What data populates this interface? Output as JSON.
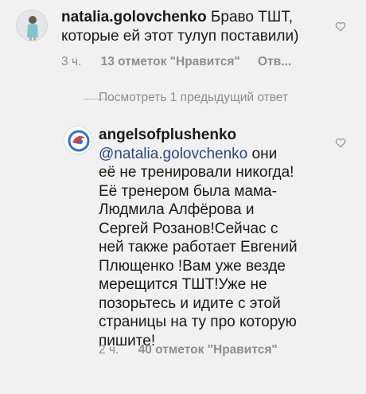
{
  "comment1": {
    "username": "natalia.golovchenko",
    "text_first": " Браво ТШТ,",
    "text_second": "которые ей этот тулуп поставили)",
    "time": "3 ч.",
    "likes": "13 отметок \"Нравится\"",
    "reply": "Отв..."
  },
  "view_previous": "Посмотреть 1 предыдущий ответ",
  "comment2": {
    "username": "angelsofplushenko",
    "mention": "@natalia.golovchenko",
    "lines": [
      "  они",
      "её не тренировали никогда!",
      "Её тренером была мама-",
      "Людмила Алфёрова  и",
      "Сергей Розанов!Сейчас с",
      "ней также работает Евгений",
      "Плющенко !Вам уже везде",
      "мерещится ТШТ!Уже не",
      "позорьтесь и идите с этой",
      "страницы на ту про которую",
      "пишите!"
    ],
    "time": "2 ч.",
    "likes": "40 отметок \"Нравится\""
  },
  "colors": {
    "background": "#f1f1f1",
    "meta_text": "#8e8e8e",
    "mention": "#2a4a7a"
  },
  "icons": {
    "like": "heart-outline-icon"
  }
}
